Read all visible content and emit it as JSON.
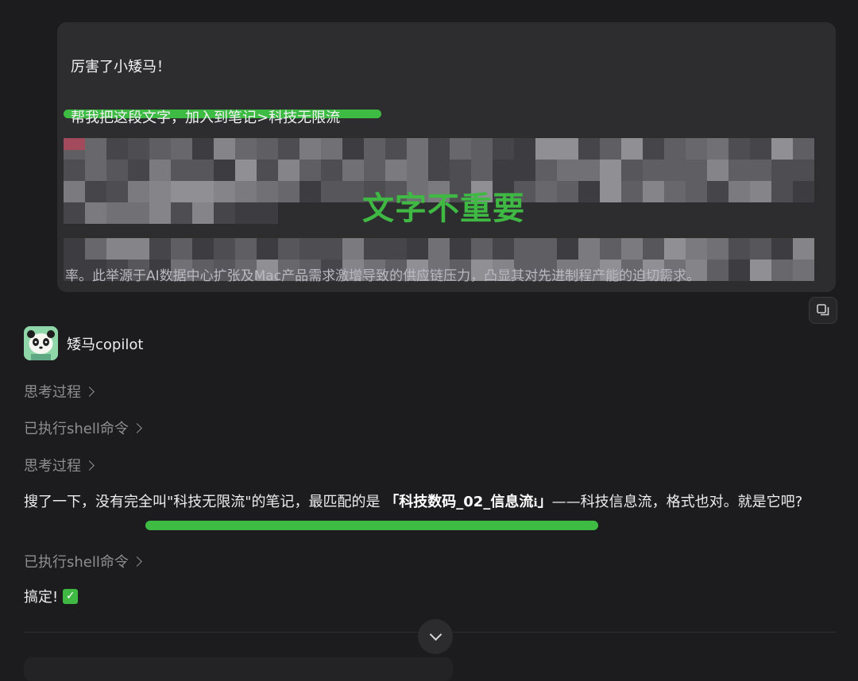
{
  "user_message": {
    "line1": "厉害了小矮马！",
    "line2": "帮我把这段文字，加入到笔记>科技无限流",
    "blurred_tail": "率。此举源于AI数据中心扩张及Mac产品需求激增导致的供应链压力，凸显其对先进制程产能的迫切需求。",
    "overlay_label": "文字不重要"
  },
  "assistant": {
    "name": "矮马copilot",
    "steps": [
      {
        "label": "思考过程"
      },
      {
        "label": "已执行shell命令"
      },
      {
        "label": "思考过程"
      }
    ],
    "reply": {
      "before": "搜了一下，没有完全叫\"科技无限流\"的笔记，最匹配的是 ",
      "highlight": "「科技数码_02_信息流",
      "info_glyph": "ℹ",
      "highlight_end": "」",
      "after": "——科技信息流，格式也对。就是它吧?"
    },
    "step_after": {
      "label": "已执行shell命令"
    },
    "done": "搞定!",
    "done_emoji": "✓"
  },
  "colors": {
    "background": "#1c1c1e",
    "bubble": "#2d2d30",
    "highlight_green": "#3dbb42",
    "muted_text": "#8e8e93"
  },
  "icons": {
    "copy": "copy-icon",
    "scroll_down": "chevron-down-icon",
    "avatar": "panda-avatar",
    "check": "check-mark-icon"
  }
}
